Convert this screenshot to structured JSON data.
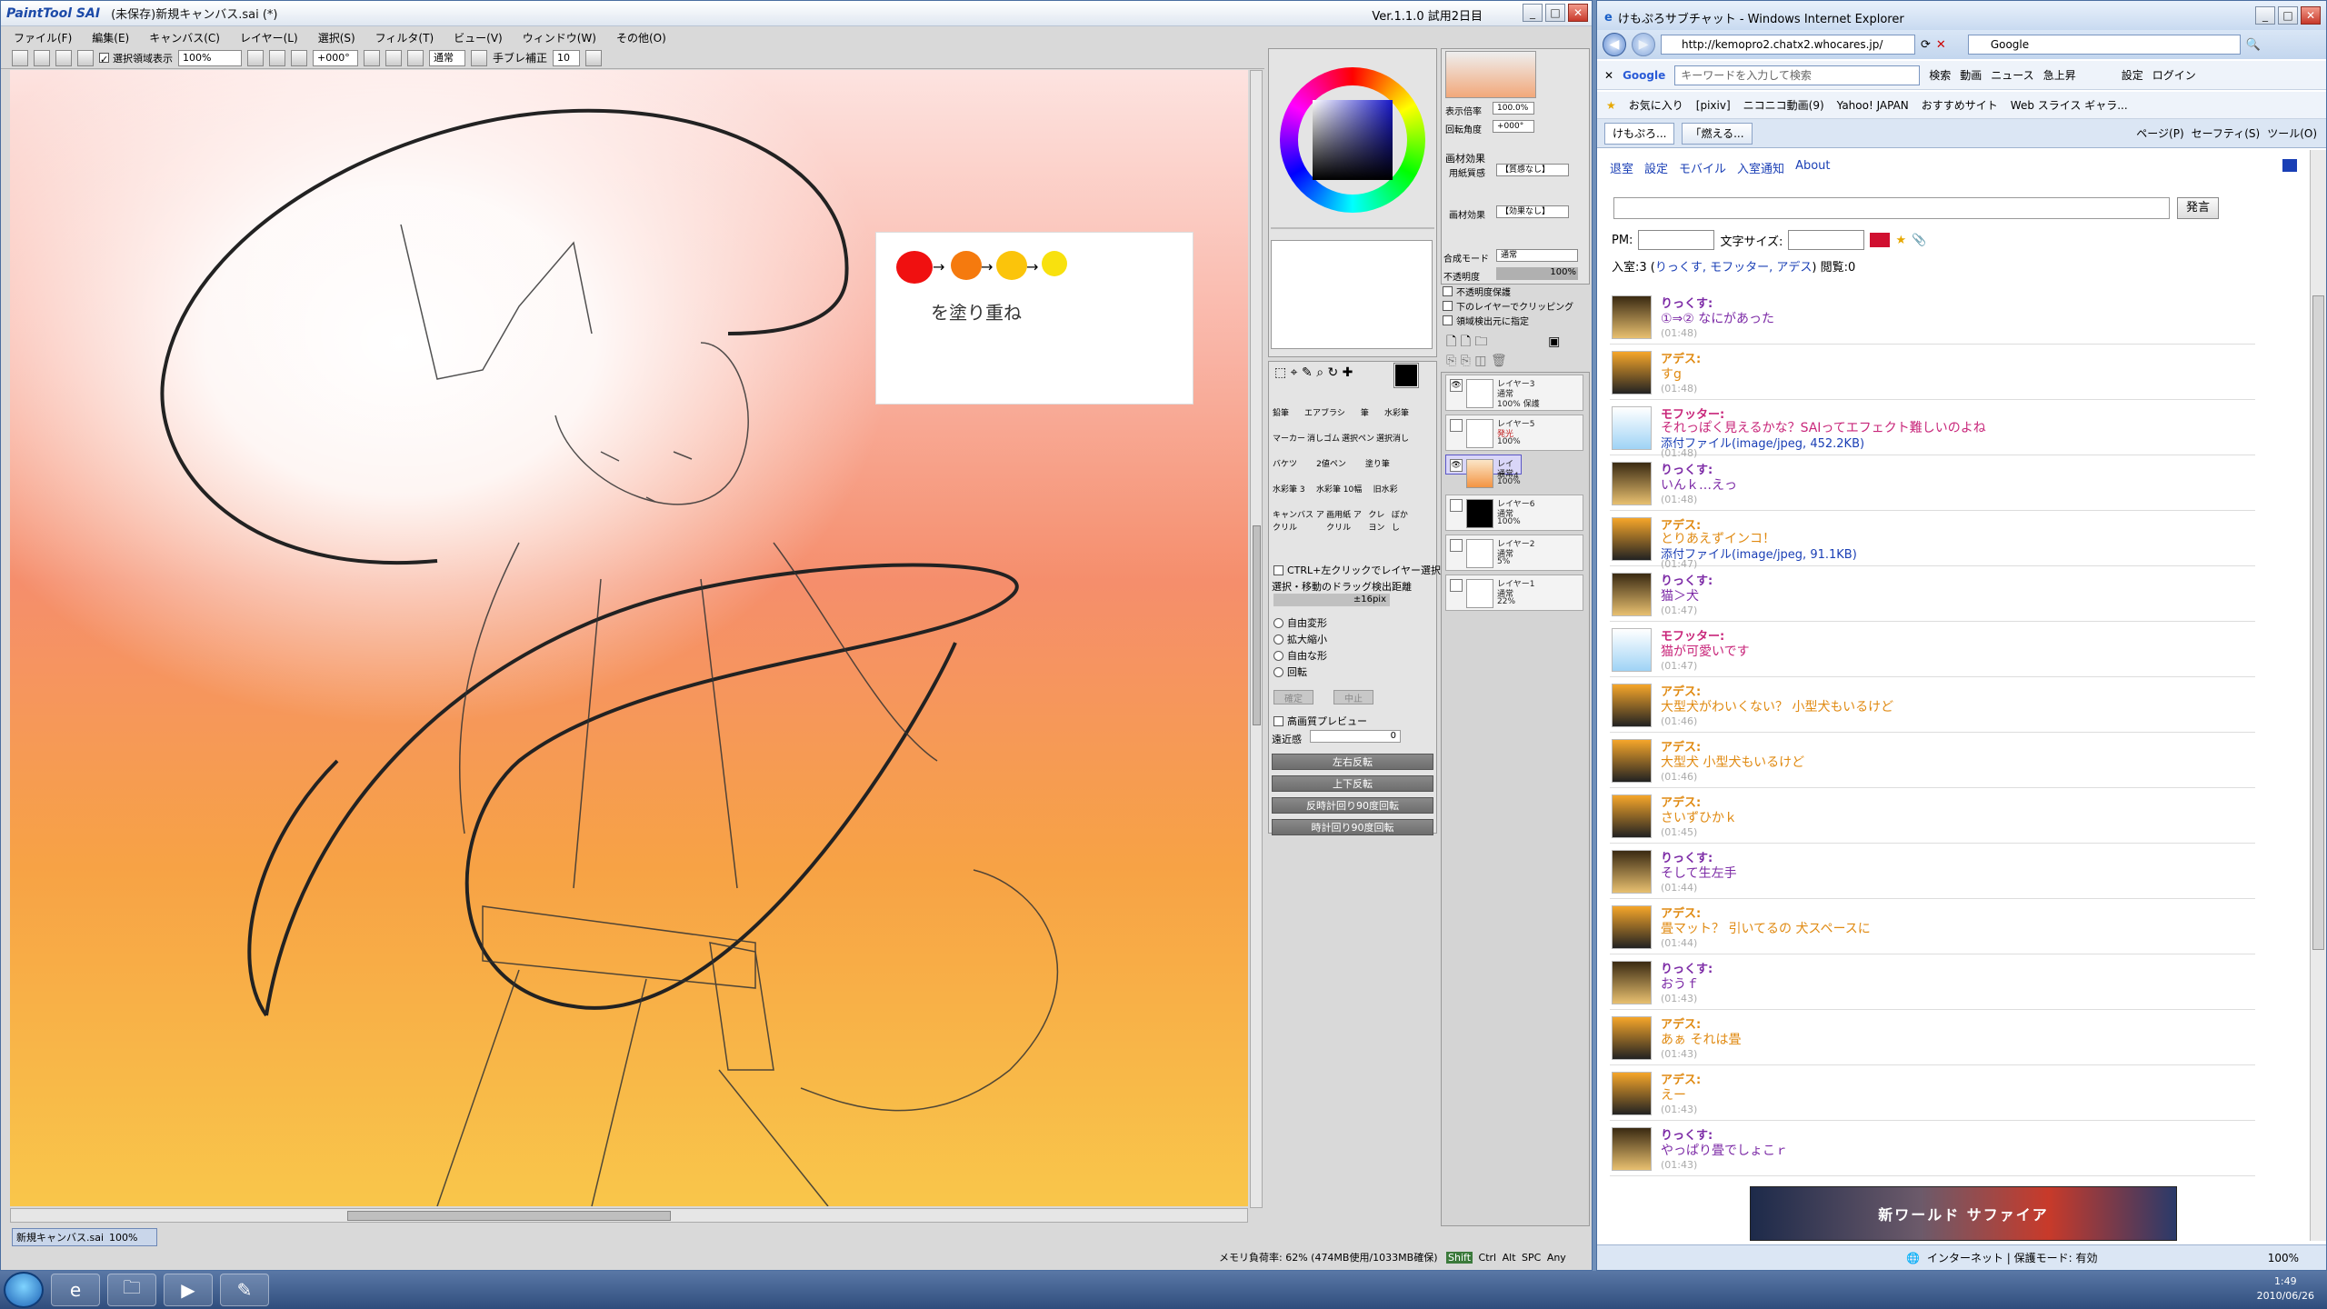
{
  "sai": {
    "logo": "PaintTool SAI",
    "title": "(未保存)新規キャンバス.sai (*)",
    "version": "Ver.1.1.0 試用2日目",
    "menu": [
      "ファイル(F)",
      "編集(E)",
      "キャンバス(C)",
      "レイヤー(L)",
      "選択(S)",
      "フィルタ(T)",
      "ビュー(V)",
      "ウィンドウ(W)",
      "その他(O)"
    ],
    "toolbar": {
      "selection_display_label": "選択領域表示",
      "zoom": "100%",
      "rotation": "+000°",
      "blend_mode": "通常",
      "stabilizer_label": "手ブレ補正",
      "stabilizer_value": "10"
    },
    "canvas_note": "を塗り重ね",
    "canvas_tab": {
      "name": "新規キャンバス.sai",
      "zoom": "100%"
    },
    "status": "メモリ負荷率: 62% (474MB使用/1033MB確保)",
    "status_keys": [
      "Shift",
      "Ctrl",
      "Alt",
      "SPC",
      "Any"
    ],
    "nav": {
      "zoom_label": "表示倍率",
      "zoom_value": "100.0%",
      "angle_label": "回転角度",
      "angle_value": "+000°"
    },
    "material": {
      "header": "画材効果",
      "paper_label": "用紙質感",
      "paper_value": "【質感なし】",
      "effect_label": "画材効果",
      "effect_value": "【効果なし】"
    },
    "blend": {
      "label": "合成モード",
      "value": "通常"
    },
    "opacity": {
      "label": "不透明度",
      "value": "100%"
    },
    "layer_options": [
      "不透明度保護",
      "下のレイヤーでクリッピング",
      "領域検出元に指定"
    ],
    "layers": [
      {
        "name": "レイヤー3",
        "mode": "通常",
        "opacity": "100% 保護"
      },
      {
        "name": "レイヤー5",
        "mode": "発光",
        "opacity": "100%"
      },
      {
        "name": "レイヤー4",
        "mode": "通常",
        "opacity": "100%"
      },
      {
        "name": "レイヤー6",
        "mode": "通常",
        "opacity": "100%"
      },
      {
        "name": "レイヤー2",
        "mode": "通常",
        "opacity": "5%"
      },
      {
        "name": "レイヤー1",
        "mode": "通常",
        "opacity": "22%"
      }
    ],
    "tools": [
      [
        "鉛筆",
        "エアブラシ",
        "筆",
        "水彩筆"
      ],
      [
        "マーカー",
        "消しゴム",
        "選択ペン",
        "選択消し"
      ],
      [
        "バケツ",
        "2値ペン",
        "塗り筆",
        ""
      ],
      [
        "水彩筆\n3",
        "水彩筆\n10幅",
        "旧水彩",
        ""
      ],
      [
        "キャンバス\nアクリル",
        "画用紙\nアクリル",
        "クレヨン",
        "ぼかし"
      ]
    ],
    "transform": {
      "ctrl_click_label": "CTRL+左クリックでレイヤー選択",
      "drag_label": "選択・移動のドラッグ検出距離",
      "drag_value": "±16pix",
      "options": [
        "自由変形",
        "拡大縮小",
        "自由な形",
        "回転"
      ],
      "ok": "確定",
      "cancel": "中止",
      "hq_preview": "高画質プレビュー",
      "perspective_label": "遠近感",
      "perspective_value": "0",
      "buttons": [
        "左右反転",
        "上下反転",
        "反時計回り90度回転",
        "時計回り90度回転"
      ]
    }
  },
  "ie": {
    "title": "けもぷろサブチャット - Windows Internet Explorer",
    "url": "http://kemopro2.chatx2.whocares.jp/",
    "search_engine": "Google",
    "google_bar": {
      "placeholder": "キーワードを入力して検索",
      "search": "検索",
      "items": [
        "動画",
        "ニュース",
        "急上昇"
      ],
      "settings": "設定",
      "login": "ログイン"
    },
    "favorites": [
      "お気に入り",
      "[pixiv]",
      "ニコニコ動画(9)",
      "Yahoo! JAPAN",
      "おすすめサイト",
      "Web スライス ギャラ..."
    ],
    "tabs": [
      "けもぷろ...",
      "「燃える..."
    ],
    "command_bar": [
      "ページ(P)",
      "セーフティ(S)",
      "ツール(O)"
    ],
    "chat_nav": [
      "退室",
      "設定",
      "モバイル",
      "入室通知",
      "About"
    ],
    "send": "発言",
    "pm_label": "PM:",
    "font_size_label": "文字サイズ:",
    "room_info": {
      "prefix": "入室:3 (",
      "members": "りっくす, モフッター, アデス",
      "suffix": ") 閲覧:0"
    },
    "messages": [
      {
        "user": "りっくす:",
        "text": "①⇒② なにがあった",
        "time": "(01:48)",
        "who": "rikkusu"
      },
      {
        "user": "アデス:",
        "text": "すg",
        "time": "(01:48)",
        "who": "adesu"
      },
      {
        "user": "モフッター:",
        "text": "それっぽく見えるかな？SAIってエフェクト難しいのよね",
        "attach": "添付ファイル(image/jpeg, 452.2KB)",
        "time": "(01:48)",
        "who": "mofu"
      },
      {
        "user": "りっくす:",
        "text": "いんｋ…えっ",
        "time": "(01:48)",
        "who": "rikkusu"
      },
      {
        "user": "アデス:",
        "text": "とりあえずインコ！",
        "attach": "添付ファイル(image/jpeg, 91.1KB)",
        "time": "(01:47)",
        "who": "adesu"
      },
      {
        "user": "りっくす:",
        "text": "猫＞犬",
        "time": "(01:47)",
        "who": "rikkusu"
      },
      {
        "user": "モフッター:",
        "text": "猫が可愛いです",
        "time": "(01:47)",
        "who": "mofu"
      },
      {
        "user": "アデス:",
        "text": "大型犬がわいくない？ 小型犬もいるけど",
        "time": "(01:46)",
        "who": "adesu"
      },
      {
        "user": "アデス:",
        "text": "大型犬 小型犬もいるけど",
        "time": "(01:46)",
        "who": "adesu"
      },
      {
        "user": "アデス:",
        "text": "さいずひかｋ",
        "time": "(01:45)",
        "who": "adesu"
      },
      {
        "user": "りっくす:",
        "text": "そして生左手",
        "time": "(01:44)",
        "who": "rikkusu"
      },
      {
        "user": "アデス:",
        "text": "畳マット？ 引いてるの 犬スペースに",
        "time": "(01:44)",
        "who": "adesu"
      },
      {
        "user": "りっくす:",
        "text": "おうｆ",
        "time": "(01:43)",
        "who": "rikkusu"
      },
      {
        "user": "アデス:",
        "text": "あぁ それは畳",
        "time": "(01:43)",
        "who": "adesu"
      },
      {
        "user": "アデス:",
        "text": "えー",
        "time": "(01:43)",
        "who": "adesu"
      },
      {
        "user": "りっくす:",
        "text": "やっぱり畳でしょこｒ",
        "time": "(01:43)",
        "who": "rikkusu"
      }
    ],
    "banner": "新ワールド サファイア",
    "status": {
      "zone": "インターネット | 保護モード: 有効",
      "zoom": "100%"
    }
  },
  "taskbar": {
    "time": "1:49",
    "date": "2010/06/26"
  },
  "colors": {
    "rikkusu": "#7c2aa6",
    "adesu": "#e08a12",
    "mofu": "#c8267a",
    "accent": "#1a3fb5"
  }
}
